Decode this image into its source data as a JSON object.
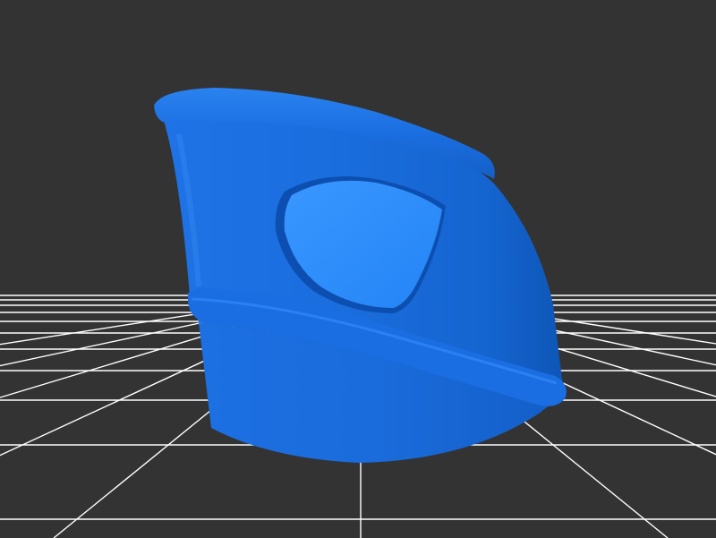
{
  "viewport": {
    "background_color": "#333333",
    "grid_color": "#ffffff",
    "model_color": "#1a6fe0",
    "model_highlight_color": "#2a8cff",
    "model_shadow_color": "#0a4fb3"
  },
  "scene": {
    "object": "3d-model-blue-spout",
    "ground": "grid-plane"
  }
}
